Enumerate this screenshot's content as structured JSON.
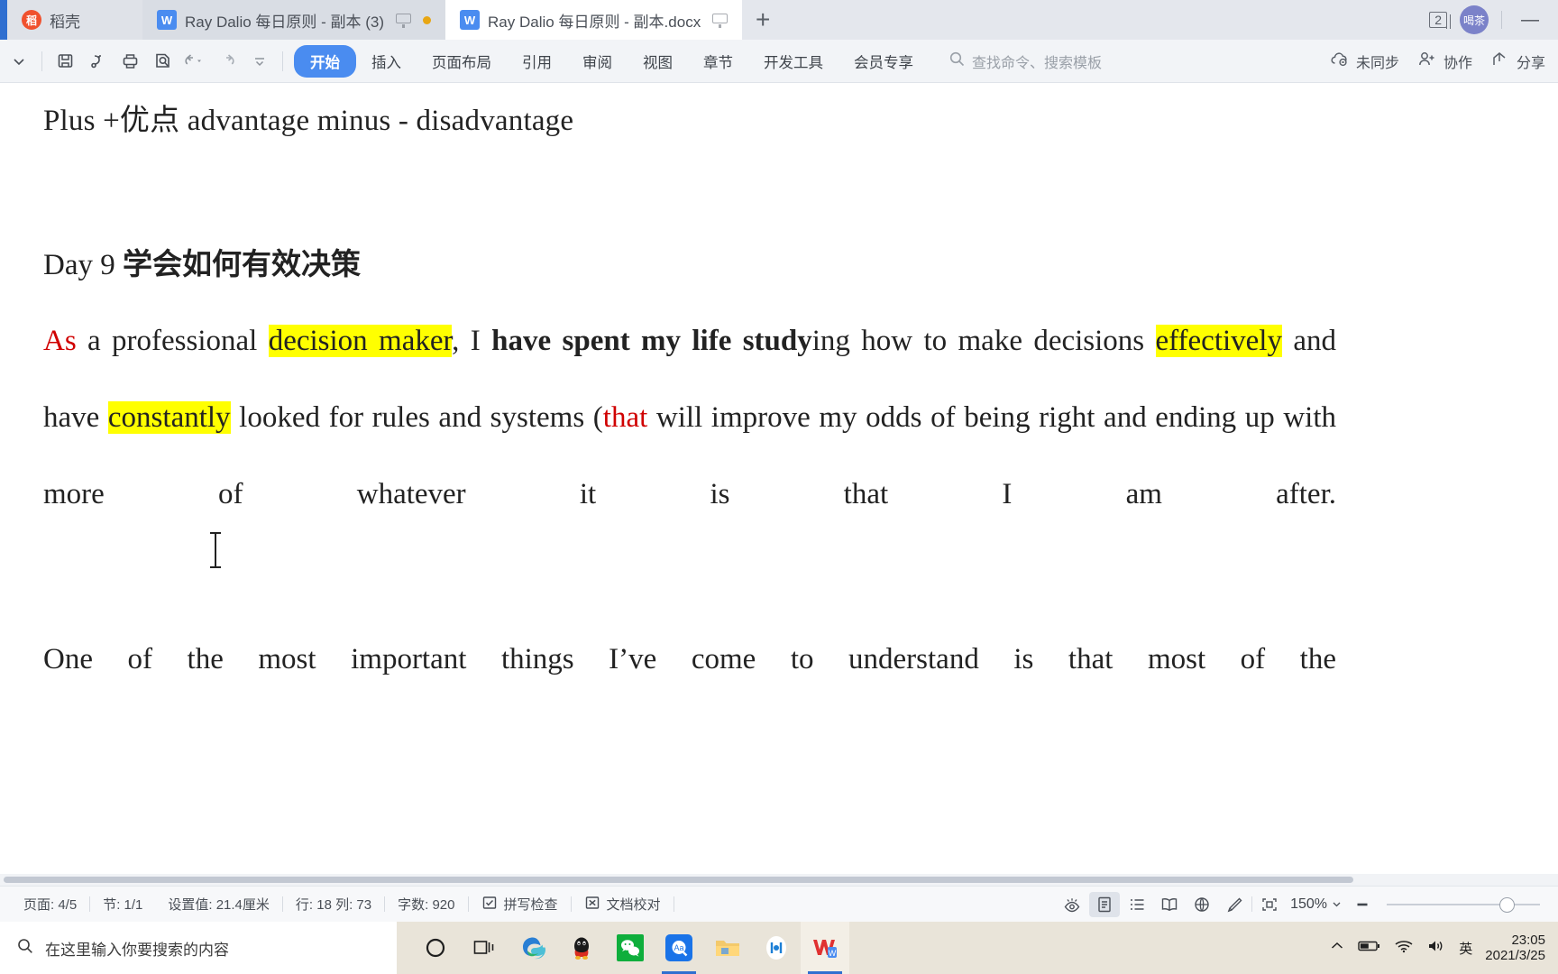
{
  "window": {
    "tabs": [
      {
        "label": "稻壳",
        "icon": "daoke-icon",
        "state": "home"
      },
      {
        "label": "Ray Dalio 每日原则 - 副本 (3)",
        "icon": "wps-writer-icon",
        "state": "inactive"
      },
      {
        "label": "Ray Dalio 每日原则 - 副本.docx",
        "icon": "wps-writer-icon",
        "state": "active"
      }
    ],
    "new_tab_label": "+",
    "tab_count": "2",
    "avatar_label": "喝茶",
    "minimize_label": "—"
  },
  "ribbon": {
    "quick_access": [
      "chevron-down-icon",
      "save-icon",
      "export-icon",
      "print-icon",
      "print-preview-icon",
      "undo-icon",
      "redo-icon",
      "more-icon"
    ],
    "tabs": [
      {
        "label": "开始",
        "active": true
      },
      {
        "label": "插入",
        "active": false
      },
      {
        "label": "页面布局",
        "active": false
      },
      {
        "label": "引用",
        "active": false
      },
      {
        "label": "审阅",
        "active": false
      },
      {
        "label": "视图",
        "active": false
      },
      {
        "label": "章节",
        "active": false
      },
      {
        "label": "开发工具",
        "active": false
      },
      {
        "label": "会员专享",
        "active": false
      }
    ],
    "search_placeholder": "查找命令、搜索模板",
    "right_items": [
      {
        "label": "未同步",
        "icon": "cloud-off-icon"
      },
      {
        "label": "协作",
        "icon": "person-add-icon"
      },
      {
        "label": "分享",
        "icon": "share-icon"
      }
    ]
  },
  "document": {
    "line1": "Plus +优点  advantage    minus - disadvantage",
    "heading_prefix": "Day 9 ",
    "heading_bold": "学会如何有效决策",
    "paragraph1": {
      "runs": [
        {
          "text": "As",
          "style": "red"
        },
        {
          "text": " a professional ",
          "style": "plain"
        },
        {
          "text": "decision maker",
          "style": "highlight"
        },
        {
          "text": ", I ",
          "style": "plain"
        },
        {
          "text": "have spent my life study",
          "style": "bold"
        },
        {
          "text": "ing how to make decisions ",
          "style": "plain"
        },
        {
          "text": "effectively",
          "style": "highlight"
        },
        {
          "text": " and have ",
          "style": "plain"
        },
        {
          "text": "constantly",
          "style": "highlight"
        },
        {
          "text": " looked for rules and systems (",
          "style": "plain"
        },
        {
          "text": "that",
          "style": "red"
        },
        {
          "text": " will improve my odds of being right and ending up with more of whatever it is that I am after.",
          "style": "plain"
        }
      ]
    },
    "paragraph2": "One of the most important things I’ve come to understand is that most of the"
  },
  "status": {
    "left_items": [
      "页面: 4/5",
      "节: 1/1",
      "设置值: 21.4厘米",
      "行: 18  列: 73",
      "字数: 920"
    ],
    "spellcheck_label": "拼写检查",
    "proofread_label": "文档校对",
    "view_buttons": [
      {
        "name": "focus-eye-icon",
        "active": false
      },
      {
        "name": "page-layout-icon",
        "active": true
      },
      {
        "name": "outline-icon",
        "active": false
      },
      {
        "name": "reading-icon",
        "active": false
      },
      {
        "name": "web-layout-icon",
        "active": false
      },
      {
        "name": "edit-pen-icon",
        "active": false
      }
    ],
    "fit_page_icon": "fit-page-icon",
    "zoom_level": "150%",
    "zoom_out_label": "—"
  },
  "taskbar": {
    "search_placeholder": "在这里输入你要搜索的内容",
    "apps": [
      {
        "name": "cortana-icon"
      },
      {
        "name": "task-view-icon"
      },
      {
        "name": "edge-icon"
      },
      {
        "name": "qq-icon"
      },
      {
        "name": "wechat-icon"
      },
      {
        "name": "dictionary-icon"
      },
      {
        "name": "file-explorer-icon"
      },
      {
        "name": "media-icon"
      },
      {
        "name": "wps-office-icon"
      }
    ],
    "ime_label": "英",
    "time": "23:05",
    "date": "2021/3/25"
  },
  "colors": {
    "accent_blue": "#4a8cf0",
    "highlight_yellow": "#ffff00",
    "red_text": "#d00000",
    "tabbar_bg": "#e4e7ed"
  }
}
